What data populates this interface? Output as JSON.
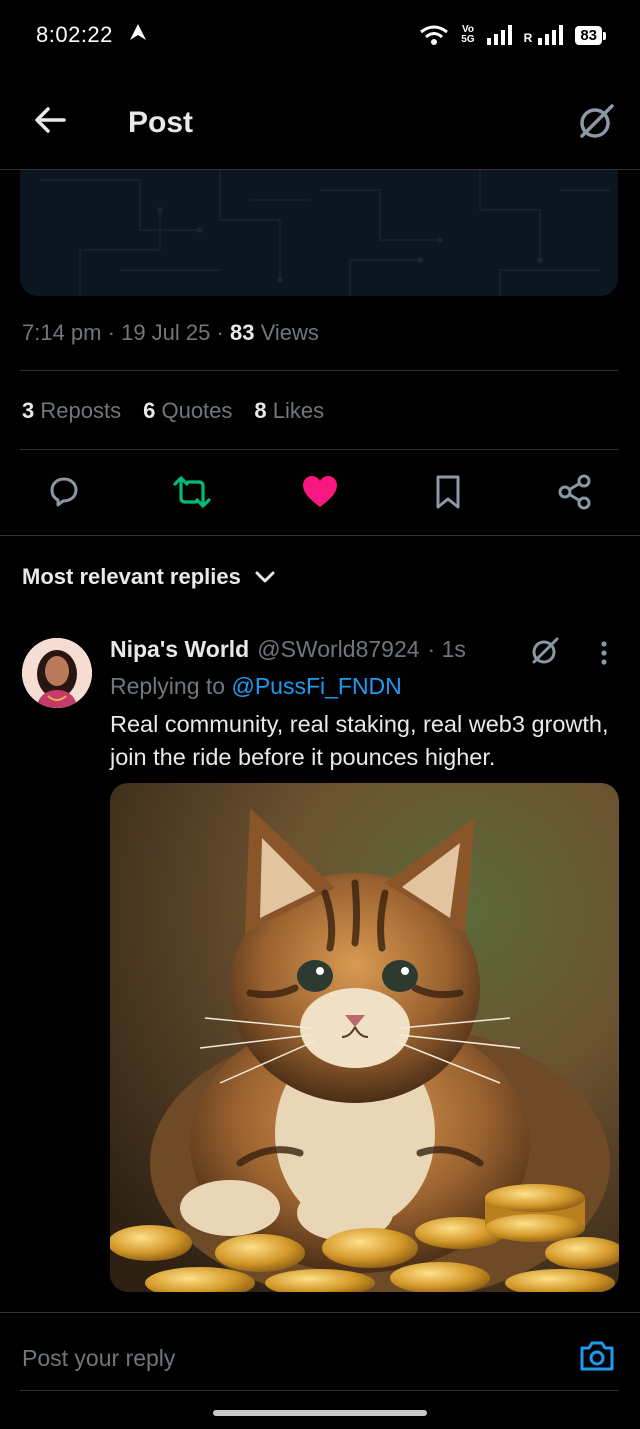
{
  "status_bar": {
    "time": "8:02:22",
    "network_label_top": "Vo",
    "network_label_bottom": "5G",
    "battery": "83"
  },
  "header": {
    "title": "Post"
  },
  "post_meta": {
    "time": "7:14 pm",
    "date": "19 Jul 25",
    "views_count": "83",
    "views_label": "Views"
  },
  "stats": {
    "reposts_count": "3",
    "reposts_label": "Reposts",
    "quotes_count": "6",
    "quotes_label": "Quotes",
    "likes_count": "8",
    "likes_label": "Likes"
  },
  "colors": {
    "repost_active": "#00ba7c",
    "like_active": "#f91880",
    "link": "#1d9bf0",
    "muted": "#71767b"
  },
  "replies": {
    "sort_label": "Most relevant replies",
    "items": [
      {
        "name": "Nipa's World",
        "handle": "@SWorld87924",
        "time": "· 1s",
        "replying_prefix": "Replying to",
        "replying_to": "@PussFi_FNDN",
        "text": "Real community, real staking, real web3 growth, join the ride before it pounces higher."
      }
    ]
  },
  "composer": {
    "placeholder": "Post your reply"
  }
}
